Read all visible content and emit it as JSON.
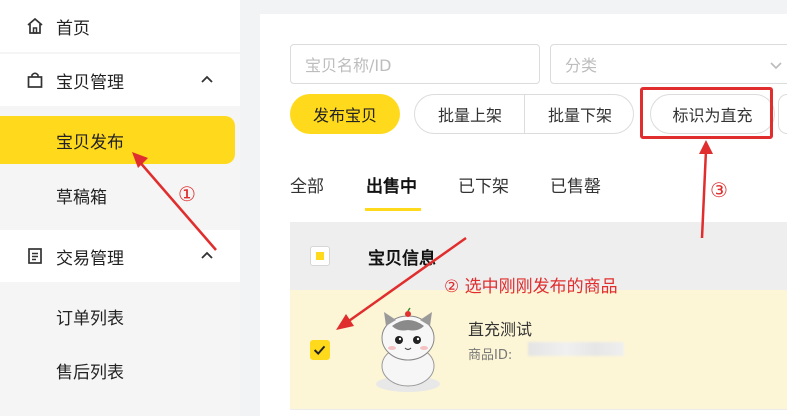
{
  "sidebar": {
    "items": [
      {
        "label": "首页",
        "icon": "home-icon"
      },
      {
        "label": "宝贝管理",
        "icon": "bag-icon",
        "expanded": true
      },
      {
        "label": "宝贝发布",
        "active": true
      },
      {
        "label": "草稿箱"
      },
      {
        "label": "交易管理",
        "icon": "document-icon",
        "expanded": true
      },
      {
        "label": "订单列表"
      },
      {
        "label": "售后列表"
      }
    ]
  },
  "filters": {
    "name_placeholder": "宝贝名称/ID",
    "category_placeholder": "分类"
  },
  "toolbar": {
    "publish_label": "发布宝贝",
    "bulk_on_label": "批量上架",
    "bulk_off_label": "批量下架",
    "mark_direct_label": "标识为直充"
  },
  "tabs": [
    {
      "label": "全部"
    },
    {
      "label": "出售中",
      "active": true
    },
    {
      "label": "已下架"
    },
    {
      "label": "已售罄"
    }
  ],
  "table": {
    "header_info": "宝贝信息",
    "rows": [
      {
        "title": "直充测试",
        "id_label": "商品ID:",
        "checked": true
      }
    ]
  },
  "annotations": {
    "step1": "①",
    "step2": "② 选中刚刚发布的商品",
    "step3": "③"
  },
  "colors": {
    "accent": "#ffd91c",
    "annotation": "#e02d2d",
    "row_highlight": "#fdf6d6"
  }
}
